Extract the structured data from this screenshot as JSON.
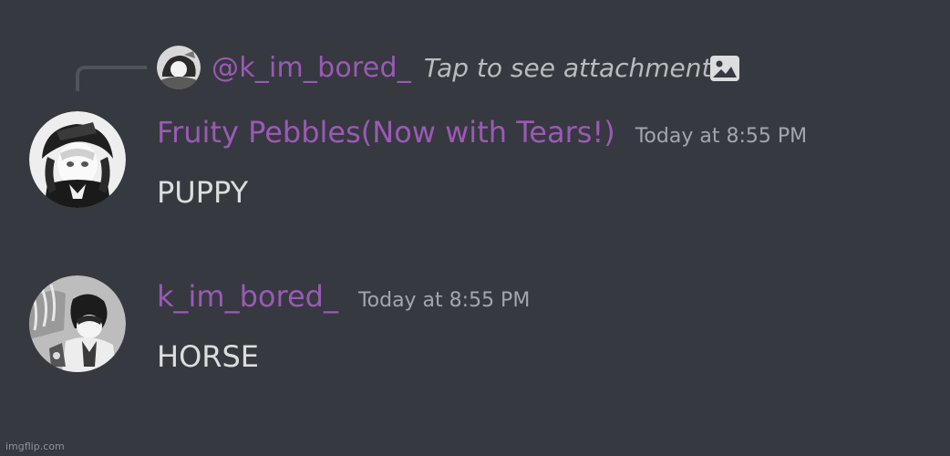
{
  "reply": {
    "author": "@k_im_bored_",
    "preview_text": "Tap to see attachment",
    "icon": "image-icon"
  },
  "messages": [
    {
      "username": "Fruity Pebbles(Now with Tears!)",
      "timestamp": "Today at 8:55 PM",
      "content": "PUPPY"
    },
    {
      "username": "k_im_bored_",
      "timestamp": "Today at 8:55 PM",
      "content": "HORSE"
    }
  ],
  "watermark": "imgflip.com",
  "colors": {
    "background": "#36393f",
    "username": "#9b59b6",
    "timestamp": "#a3a6aa",
    "message_text": "#dcddde",
    "reply_text": "#b9bbbe",
    "reply_spine": "#4f545c"
  }
}
